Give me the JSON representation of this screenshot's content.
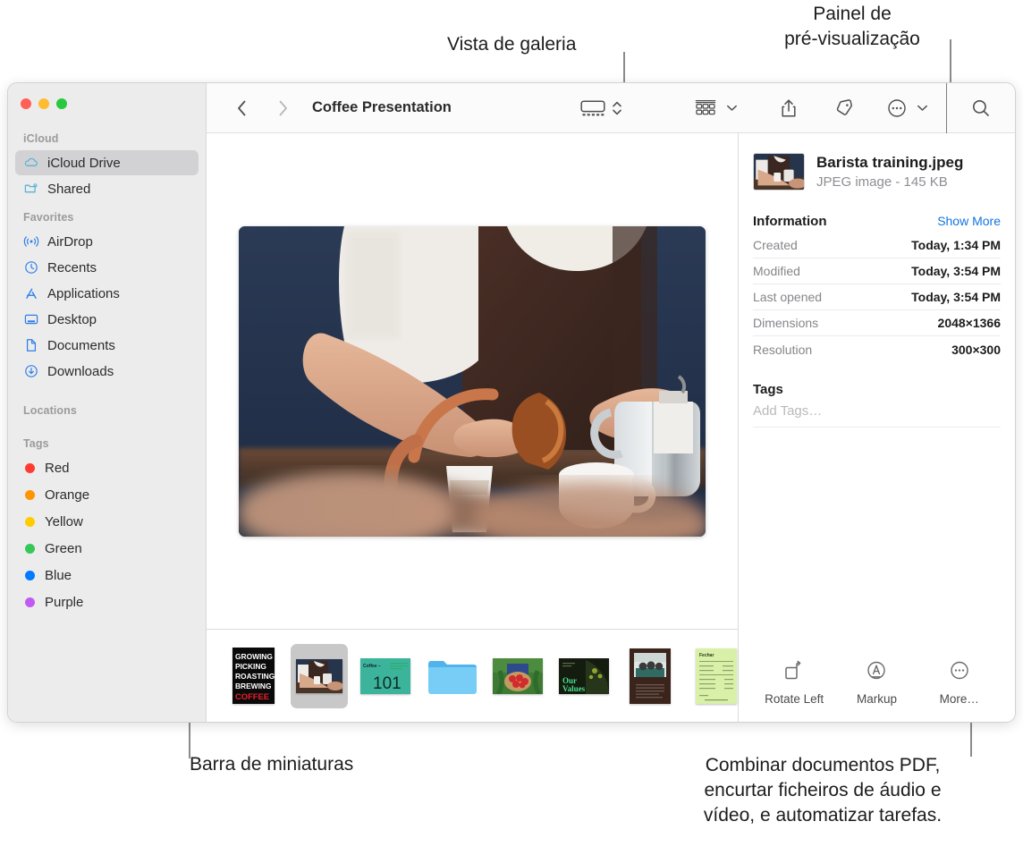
{
  "callouts": {
    "gallery_view": "Vista de galeria",
    "preview_panel": "Painel de\npré-visualização",
    "thumbnail_bar": "Barra de miniaturas",
    "bottom_right": "Combinar documentos PDF,\nencurtar ficheiros de áudio e\nvídeo, e automatizar tarefas."
  },
  "window": {
    "traffic_lights": {
      "close": "close-button",
      "minimize": "minimize-button",
      "zoom": "zoom-button"
    }
  },
  "toolbar": {
    "back": "back-button",
    "forward": "forward-button",
    "title": "Coffee Presentation",
    "view_gallery": "gallery-view-button",
    "view_stepper": "view-stepper",
    "group_by": "group-by-button",
    "share": "share-button",
    "tag": "tag-button",
    "more": "more-button",
    "search": "search-button"
  },
  "sidebar": {
    "sections": [
      {
        "header": "iCloud",
        "items": [
          {
            "label": "iCloud Drive",
            "icon": "cloud-icon",
            "selected": true
          },
          {
            "label": "Shared",
            "icon": "shared-folder-icon",
            "selected": false
          }
        ]
      },
      {
        "header": "Favorites",
        "items": [
          {
            "label": "AirDrop",
            "icon": "airdrop-icon",
            "selected": false
          },
          {
            "label": "Recents",
            "icon": "clock-icon",
            "selected": false
          },
          {
            "label": "Applications",
            "icon": "applications-icon",
            "selected": false
          },
          {
            "label": "Desktop",
            "icon": "desktop-icon",
            "selected": false
          },
          {
            "label": "Documents",
            "icon": "document-icon",
            "selected": false
          },
          {
            "label": "Downloads",
            "icon": "downloads-icon",
            "selected": false
          }
        ]
      },
      {
        "header": "Locations",
        "items": []
      },
      {
        "header": "Tags",
        "items": [
          {
            "label": "Red",
            "color": "#ff3b30"
          },
          {
            "label": "Orange",
            "color": "#ff9500"
          },
          {
            "label": "Yellow",
            "color": "#ffcc00"
          },
          {
            "label": "Green",
            "color": "#34c759"
          },
          {
            "label": "Blue",
            "color": "#007aff"
          },
          {
            "label": "Purple",
            "color": "#bf5af2"
          }
        ]
      }
    ]
  },
  "preview": {
    "image_alt": "barista-pouring-milk-photo"
  },
  "thumbnails": [
    {
      "name": "coffee-poster-thumbnail",
      "selected": false,
      "lines": [
        "GROWING",
        "PICKING",
        "ROASTING",
        "BREWING"
      ],
      "accent_line": "COFFEE"
    },
    {
      "name": "barista-training-thumbnail",
      "selected": true
    },
    {
      "name": "coffee-101-thumbnail",
      "selected": false,
      "title": "Coffee –",
      "big_text": "101"
    },
    {
      "name": "folder-thumbnail",
      "selected": false
    },
    {
      "name": "coffee-cherries-thumbnail",
      "selected": false
    },
    {
      "name": "our-values-thumbnail",
      "selected": false,
      "title": "Our\nValues"
    },
    {
      "name": "meeting-document-thumbnail",
      "selected": false
    },
    {
      "name": "invoice-thumbnail",
      "selected": false,
      "title": "Fechar"
    }
  ],
  "inspector": {
    "file_name": "Barista training.jpeg",
    "file_kind": "JPEG image - 145 KB",
    "information_title": "Information",
    "show_more": "Show More",
    "rows": [
      {
        "key": "Created",
        "value": "Today, 1:34 PM"
      },
      {
        "key": "Modified",
        "value": "Today, 3:54 PM"
      },
      {
        "key": "Last opened",
        "value": "Today, 3:54 PM"
      },
      {
        "key": "Dimensions",
        "value": "2048×1366"
      },
      {
        "key": "Resolution",
        "value": "300×300"
      }
    ],
    "tags_title": "Tags",
    "tags_placeholder": "Add Tags…",
    "actions": [
      {
        "label": "Rotate Left",
        "icon": "rotate-left-icon"
      },
      {
        "label": "Markup",
        "icon": "markup-icon"
      },
      {
        "label": "More…",
        "icon": "more-ellipsis-icon"
      }
    ]
  },
  "colors": {
    "accent_link": "#1175e3",
    "selection": "#d2d2d4",
    "sidebar_bg": "#ececec"
  }
}
